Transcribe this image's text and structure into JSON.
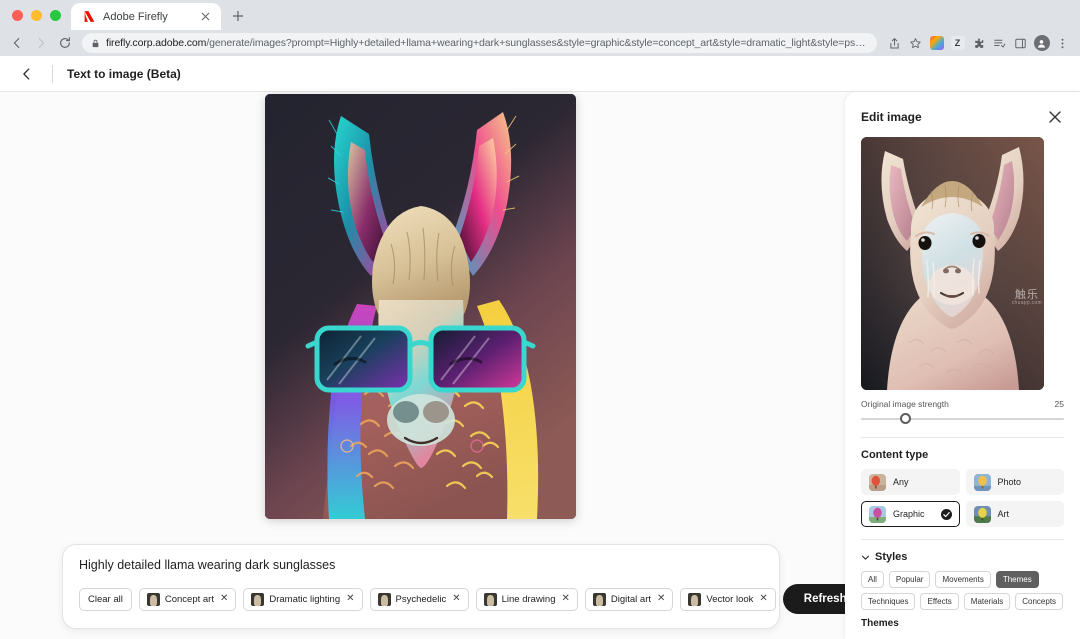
{
  "browser": {
    "tab": {
      "title": "Adobe Firefly",
      "favicon": "adobe-firefly-logo",
      "close_icon": "close-icon"
    },
    "new_tab_icon": "plus-icon",
    "nav": {
      "back_icon": "back-arrow-icon",
      "forward_icon": "forward-arrow-icon",
      "reload_icon": "reload-icon"
    },
    "omnibox": {
      "lock_icon": "lock-icon",
      "host": "firefly.corp.adobe.com",
      "path": "/generate/images?prompt=Highly+detailed+llama+wearing+dark+sunglasses&style=graphic&style=concept_art&style=dramatic_light&style=psychedelic&style=line_dra…"
    },
    "toolbar_icons": [
      "share-icon",
      "bookmark-star-icon",
      "color-extension-icon",
      "zotero-extension-icon",
      "puzzle-extension-icon",
      "reading-list-icon",
      "side-panel-icon",
      "profile-avatar-icon",
      "more-menu-icon"
    ]
  },
  "app_header": {
    "back_icon": "back-arrow-icon",
    "title": "Text to image (Beta)"
  },
  "canvas": {
    "generated_image_name": "generated-llama-image"
  },
  "prompt_bar": {
    "prompt": "Highly detailed llama wearing dark sunglasses",
    "clear_all": "Clear all",
    "tags": [
      {
        "label": "Concept art",
        "remove_icon": "close-icon"
      },
      {
        "label": "Dramatic lighting",
        "remove_icon": "close-icon"
      },
      {
        "label": "Psychedelic",
        "remove_icon": "close-icon"
      },
      {
        "label": "Line drawing",
        "remove_icon": "close-icon"
      },
      {
        "label": "Digital art",
        "remove_icon": "close-icon"
      },
      {
        "label": "Vector look",
        "remove_icon": "close-icon"
      }
    ],
    "refresh": "Refresh"
  },
  "edit_panel": {
    "title": "Edit image",
    "close_icon": "close-icon",
    "reference_image_name": "reference-llama-image",
    "watermark": {
      "text": "触乐",
      "sub": "chuapp.com"
    },
    "slider": {
      "label": "Original image strength",
      "value": "25"
    },
    "content_type": {
      "title": "Content type",
      "options": [
        {
          "label": "Any",
          "selected": false
        },
        {
          "label": "Photo",
          "selected": false
        },
        {
          "label": "Graphic",
          "selected": true
        },
        {
          "label": "Art",
          "selected": false
        }
      ],
      "check_icon": "check-circle-icon"
    },
    "styles": {
      "label": "Styles",
      "chevron_icon": "chevron-down-icon",
      "filters": [
        {
          "label": "All",
          "active": false
        },
        {
          "label": "Popular",
          "active": false
        },
        {
          "label": "Movements",
          "active": false
        },
        {
          "label": "Themes",
          "active": true
        },
        {
          "label": "Techniques",
          "active": false
        },
        {
          "label": "Effects",
          "active": false
        },
        {
          "label": "Materials",
          "active": false
        },
        {
          "label": "Concepts",
          "active": false
        }
      ],
      "group_title": "Themes"
    }
  },
  "colors": {
    "accent_dark": "#1b1b1b",
    "chrome_bg": "#dee1e6",
    "app_bg": "#fbfbfb"
  }
}
